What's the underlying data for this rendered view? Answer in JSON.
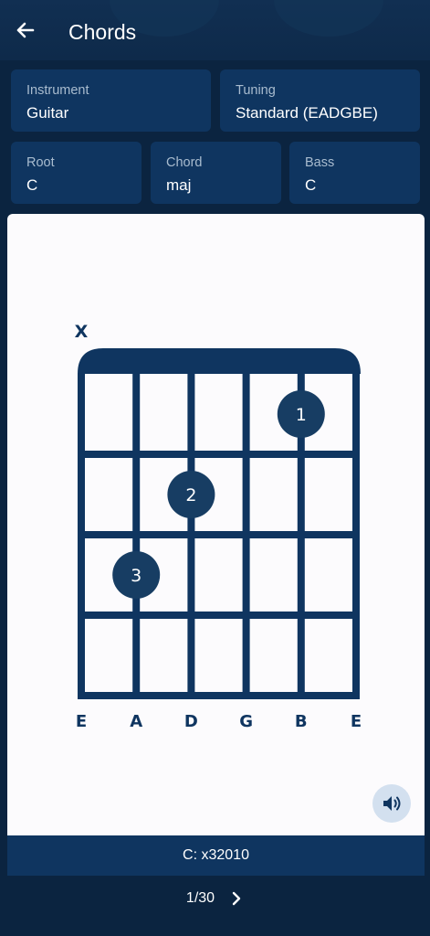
{
  "header": {
    "title": "Chords",
    "back_icon": "arrow-left-icon"
  },
  "selectors": {
    "instrument": {
      "label": "Instrument",
      "value": "Guitar"
    },
    "tuning": {
      "label": "Tuning",
      "value": "Standard (EADGBE)"
    },
    "root": {
      "label": "Root",
      "value": "C"
    },
    "chord": {
      "label": "Chord",
      "value": "maj"
    },
    "bass": {
      "label": "Bass",
      "value": "C"
    }
  },
  "diagram": {
    "muted_marker": "X",
    "strings": [
      "E",
      "A",
      "D",
      "G",
      "B",
      "E"
    ],
    "fingers": [
      {
        "string": 5,
        "fret": 1,
        "label": "1"
      },
      {
        "string": 3,
        "fret": 2,
        "label": "2"
      },
      {
        "string": 2,
        "fret": 3,
        "label": "3"
      }
    ],
    "muted_string": 1,
    "fret_count": 4
  },
  "caption": "C: x32010",
  "pager": {
    "text": "1/30",
    "next_icon": "chevron-right-icon"
  },
  "colors": {
    "accent": "#0f3560",
    "background": "#0b2440",
    "panel": "#fcfbfd"
  }
}
